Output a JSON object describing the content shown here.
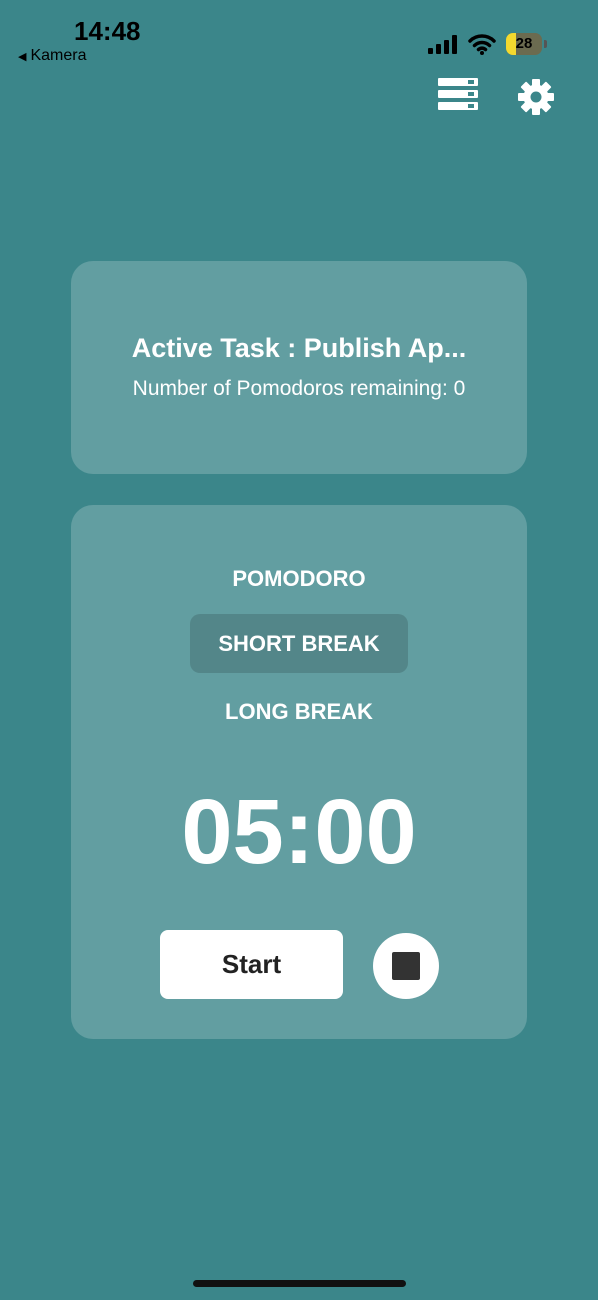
{
  "status_bar": {
    "time": "14:48",
    "back_label": "Kamera",
    "battery_level": "28",
    "battery_fraction": 0.28,
    "battery_color": "#f3d92f",
    "icons": [
      "signal-icon",
      "wifi-icon",
      "battery-icon",
      "back-arrow-icon"
    ]
  },
  "toolbar": {
    "icons": [
      "task-list-icon",
      "gear-icon"
    ]
  },
  "task_card": {
    "title": "Active Task : Publish Ap...",
    "remaining": "Number of Pomodoros remaining: 0"
  },
  "timer": {
    "modes": [
      {
        "label": "POMODORO",
        "selected": false
      },
      {
        "label": "SHORT BREAK",
        "selected": true
      },
      {
        "label": "LONG BREAK",
        "selected": false
      }
    ],
    "display": "05:00",
    "start_label": "Start",
    "stop_icon": "stop-icon"
  },
  "colors": {
    "background": "#3b868a",
    "card": "#5fa1a3",
    "text": "#ffffff",
    "button": "#ffffff",
    "button_text": "#222222"
  }
}
